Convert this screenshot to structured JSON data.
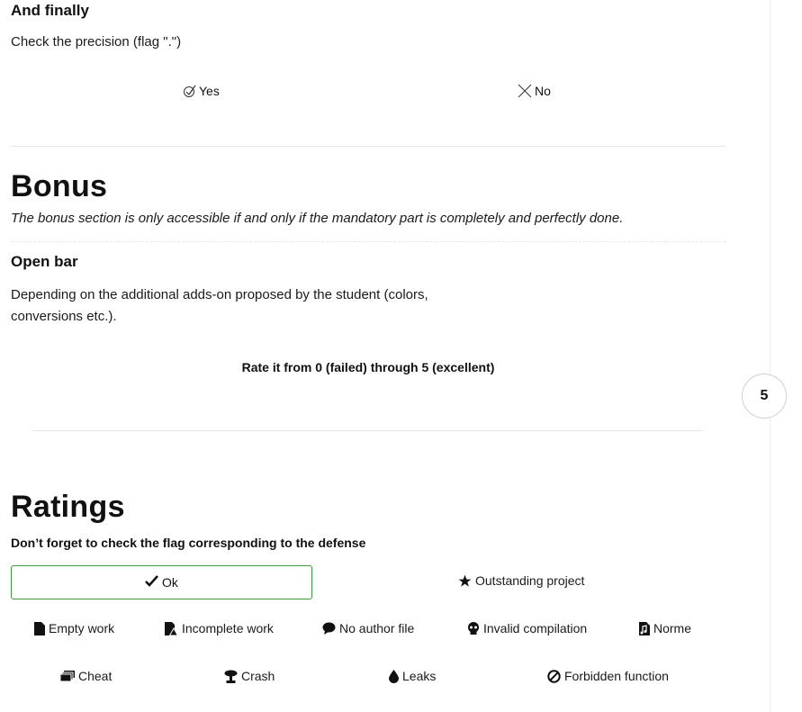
{
  "and_finally": {
    "title": "And finally",
    "description": "Check the precision (flag \".\")",
    "yes_label": "Yes",
    "no_label": "No"
  },
  "bonus": {
    "title": "Bonus",
    "note": "The bonus section is only accessible if and only if the mandatory part is completely and perfectly done.",
    "open_bar": {
      "title": "Open bar",
      "description_line1": "Depending on the additional adds-on proposed by the student (colors,",
      "description_line2": "conversions etc.).",
      "rate_label": "Rate it from 0 (failed) through 5 (excellent)",
      "score": "5"
    }
  },
  "ratings": {
    "title": "Ratings",
    "subtitle": "Don’t forget to check the flag corresponding to the defense",
    "flags": {
      "ok": "Ok",
      "outstanding": "Outstanding project",
      "empty_work": "Empty work",
      "incomplete_work": "Incomplete work",
      "no_author_file": "No author file",
      "invalid_compilation": "Invalid compilation",
      "norme": "Norme",
      "cheat": "Cheat",
      "crash": "Crash",
      "leaks": "Leaks",
      "forbidden_function": "Forbidden function"
    }
  },
  "colors": {
    "ok_border": "#3c9b3c",
    "divider": "#e6e6e6"
  }
}
